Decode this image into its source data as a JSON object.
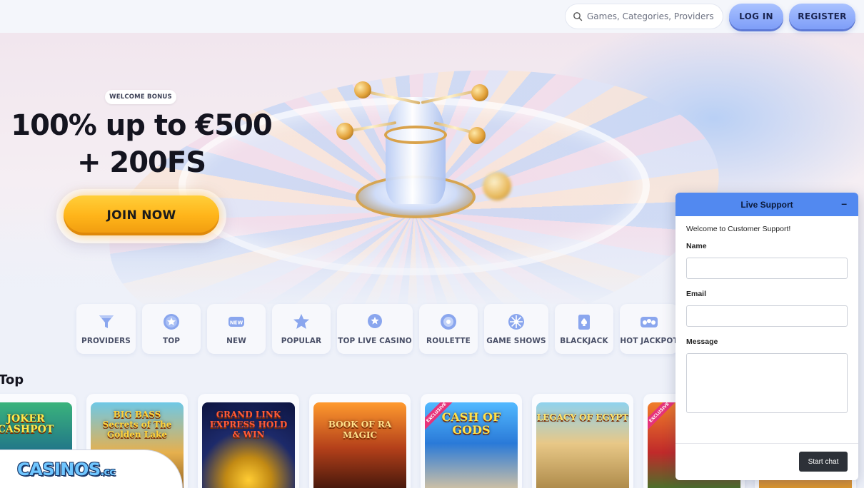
{
  "header": {
    "search_placeholder": "Games, Categories, Providers",
    "login_label": "LOG IN",
    "register_label": "REGISTER",
    "search_icon": "search-icon"
  },
  "hero": {
    "badge": "WELCOME BONUS",
    "title_line1": "100% up to €500",
    "title_line2": "+ 200FS",
    "cta_label": "JOIN NOW"
  },
  "categories": [
    {
      "label": "PROVIDERS",
      "icon": "funnel-icon"
    },
    {
      "label": "TOP",
      "icon": "badge-star-icon"
    },
    {
      "label": "NEW",
      "icon": "new-tag-icon"
    },
    {
      "label": "POPULAR",
      "icon": "star-icon"
    },
    {
      "label": "TOP LIVE CASINO",
      "icon": "live-star-icon"
    },
    {
      "label": "ROULETTE",
      "icon": "roulette-icon"
    },
    {
      "label": "GAME SHOWS",
      "icon": "wheel-icon"
    },
    {
      "label": "BLACKJACK",
      "icon": "card-icon"
    },
    {
      "label": "HOT JACKPOT",
      "icon": "coins-icon"
    }
  ],
  "section": {
    "title": "Top"
  },
  "games": [
    {
      "title": "JOKER CASHPOT",
      "exclusive": false
    },
    {
      "title": "BIG BASS Secrets of The Golden Lake",
      "exclusive": false
    },
    {
      "title": "GRAND LINK EXPRESS HOLD & WIN",
      "exclusive": false
    },
    {
      "title": "BOOK OF RA MAGIC",
      "exclusive": false
    },
    {
      "title": "CASH OF GODS",
      "exclusive": true,
      "badge": "EXCLUSIVE"
    },
    {
      "title": "LEGACY OF EGYPT",
      "exclusive": false
    },
    {
      "title": "",
      "exclusive": true,
      "badge": "EXCLUSIVE"
    }
  ],
  "logo": {
    "text": "CASINOS",
    "suffix": ".cc"
  },
  "chat": {
    "title": "Live Support",
    "minimize": "–",
    "welcome": "Welcome to Customer Support!",
    "name_label": "Name",
    "email_label": "Email",
    "message_label": "Message",
    "start_label": "Start chat"
  },
  "colors": {
    "accent": "#7e9ef8",
    "cta": "#ffb51a",
    "chat_header": "#5289f0",
    "chat_button": "#2d3138"
  }
}
